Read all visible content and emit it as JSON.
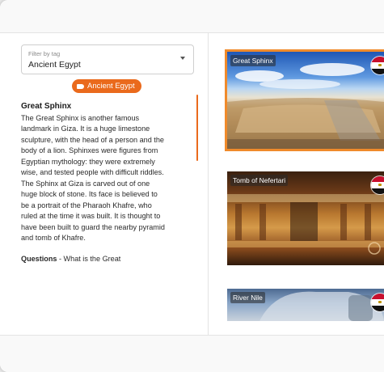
{
  "filter": {
    "label": "Filter by tag",
    "value": "Ancient Egypt"
  },
  "tag_chip": {
    "label": "Ancient Egypt",
    "color": "#ea6a1c"
  },
  "description": {
    "title": "Great Sphinx",
    "body": "The Great Sphinx is another famous landmark in Giza. It is a huge limestone sculpture, with the head of a person and the body of a lion. Sphinxes were figures from Egyptian mythology: they were extremely wise, and tested people with difficult riddles. The Sphinx at Giza is carved out of one huge block of stone. Its face is believed to be a portrait of the Pharaoh Khafre, who ruled at the time it was built. It is thought to have been built to guard the nearby pyramid and tomb of Khafre.",
    "questions_label": "Questions",
    "questions_text": " - What is the Great"
  },
  "cards": [
    {
      "label": "Great Sphinx",
      "flag": "egypt-flag-icon",
      "selected": true
    },
    {
      "label": "Tomb of Nefertari",
      "flag": "egypt-flag-icon",
      "selected": false
    },
    {
      "label": "River Nile",
      "flag": "egypt-flag-icon",
      "selected": false
    }
  ],
  "colors": {
    "accent": "#ea6a1c",
    "selected_outline": "#f08a2b"
  }
}
